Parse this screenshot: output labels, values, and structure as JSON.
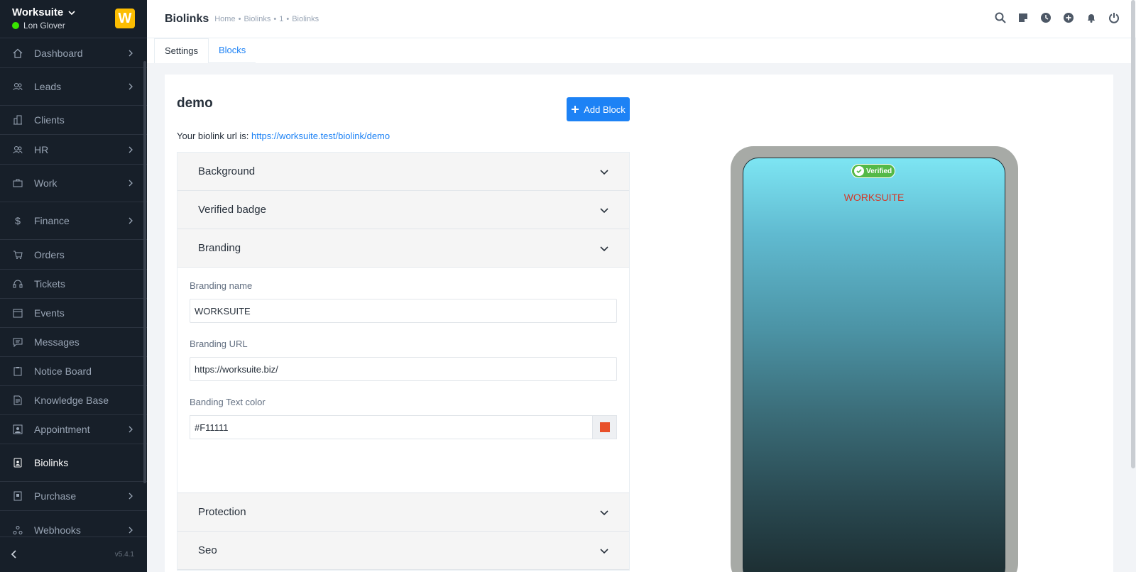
{
  "sidebar": {
    "company": "Worksuite",
    "user": "Lon Glover",
    "logo_letter": "W",
    "version": "v5.4.1",
    "items": [
      {
        "label": "Dashboard",
        "icon": "house-icon",
        "chevron": true
      },
      {
        "label": "Leads",
        "icon": "people-icon",
        "chevron": true
      },
      {
        "label": "Clients",
        "icon": "building-icon",
        "chevron": false
      },
      {
        "label": "HR",
        "icon": "people-icon",
        "chevron": true
      },
      {
        "label": "Work",
        "icon": "briefcase-icon",
        "chevron": true
      },
      {
        "label": "Finance",
        "icon": "dollar-icon",
        "chevron": true
      },
      {
        "label": "Orders",
        "icon": "cart-icon",
        "chevron": false
      },
      {
        "label": "Tickets",
        "icon": "headset-icon",
        "chevron": false
      },
      {
        "label": "Events",
        "icon": "calendar-icon",
        "chevron": false
      },
      {
        "label": "Messages",
        "icon": "chat-icon",
        "chevron": false
      },
      {
        "label": "Notice Board",
        "icon": "clipboard-icon",
        "chevron": false
      },
      {
        "label": "Knowledge Base",
        "icon": "document-icon",
        "chevron": false
      },
      {
        "label": "Appointment",
        "icon": "person-badge-icon",
        "chevron": true
      },
      {
        "label": "Biolinks",
        "icon": "badge-icon",
        "chevron": false
      },
      {
        "label": "Purchase",
        "icon": "receipt-icon",
        "chevron": true
      },
      {
        "label": "Webhooks",
        "icon": "webhook-icon",
        "chevron": true
      }
    ]
  },
  "header": {
    "title": "Biolinks",
    "breadcrumb": [
      "Home",
      "•",
      "Biolinks",
      "•",
      "1",
      "•",
      "Biolinks"
    ],
    "icons": [
      "search-icon",
      "sticky-note-icon",
      "clock-icon",
      "plus-circle-icon",
      "bell-icon",
      "power-icon"
    ]
  },
  "tabs": [
    {
      "label": "Settings",
      "active": true
    },
    {
      "label": "Blocks",
      "active": false
    }
  ],
  "main": {
    "title": "demo",
    "add_block_label": "Add Block",
    "url_prefix": "Your biolink url is:",
    "url": "https://worksuite.test/biolink/demo"
  },
  "accordion": {
    "background": "Background",
    "verified_badge": "Verified badge",
    "branding": "Branding",
    "protection": "Protection",
    "seo": "Seo"
  },
  "branding_form": {
    "name_label": "Branding name",
    "name_value": "WORKSUITE",
    "url_label": "Branding URL",
    "url_value": "https://worksuite.biz/",
    "color_label": "Banding Text color",
    "color_value": "#F11111",
    "swatch_color": "#e8502a"
  },
  "preview": {
    "verified_label": "Verified",
    "brand_text": "WORKSUITE",
    "brand_color": "#d13b2b"
  },
  "colors": {
    "accent": "#1d82f5",
    "sidebar_bg": "#171f29",
    "verified_green": "#54b946"
  }
}
